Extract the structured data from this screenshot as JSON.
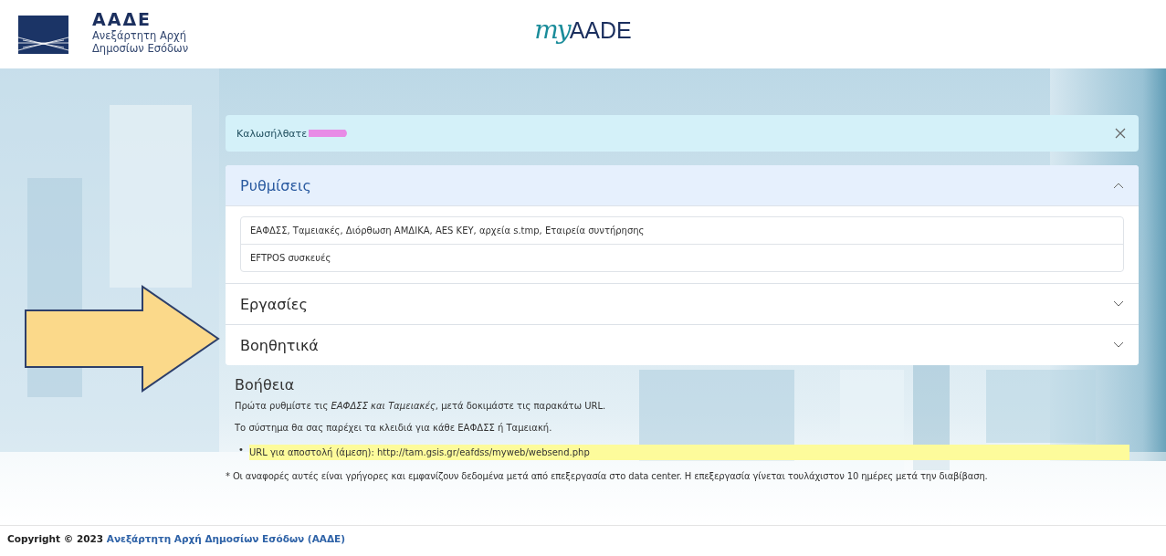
{
  "header": {
    "org_abbr": "ΑΑΔΕ",
    "org_name_line1": "Ανεξάρτητη Αρχή",
    "org_name_line2": "Δημοσίων Εσόδων",
    "app_logo": {
      "prefix": "my",
      "name": "AADE"
    }
  },
  "alert": {
    "text": "Καλωσήλθατε",
    "redacted": true
  },
  "accordion": [
    {
      "title": "Ρυθμίσεις",
      "expanded": true,
      "items": [
        "ΕΑΦΔΣΣ, Ταμειακές, Διόρθωση ΑΜΔΙΚΑ, AES KEY, αρχεία s.tmp, Εταιρεία συντήρησης",
        "EFTPOS συσκευές"
      ]
    },
    {
      "title": "Εργασίες",
      "expanded": false
    },
    {
      "title": "Βοηθητικά",
      "expanded": false
    }
  ],
  "help": {
    "title": "Βοήθεια",
    "paragraphs": [
      "Πρώτα ρυθμίστε τις *ΕΑΦΔΣΣ και Ταμειακές*, μετά δοκιμάστε τις παρακάτω URL.",
      "Το σύστημα θα σας παρέχει τα κλειδιά για κάθε ΕΑΦΔΣΣ ή Ταμειακή."
    ],
    "bullets": [
      {
        "marker": "•",
        "text": "URL για αποστολή (άμεση): http://tam.gsis.gr/eafdss/myweb/websend.php",
        "highlighted": true
      }
    ],
    "note": "* Οι αναφορές αυτές είναι γρήγορες και εμφανίζουν δεδομένα μετά από επεξεργασία στο data center. Η επεξεργασία γίνεται τουλάχιστον 10 ημέρες μετά την διαβίβαση."
  },
  "footer": {
    "copyright": "Copyright © 2023",
    "link": "Ανεξάρτητη Αρχή Δημοσίων Εσόδων (ΑΑΔΕ)"
  }
}
